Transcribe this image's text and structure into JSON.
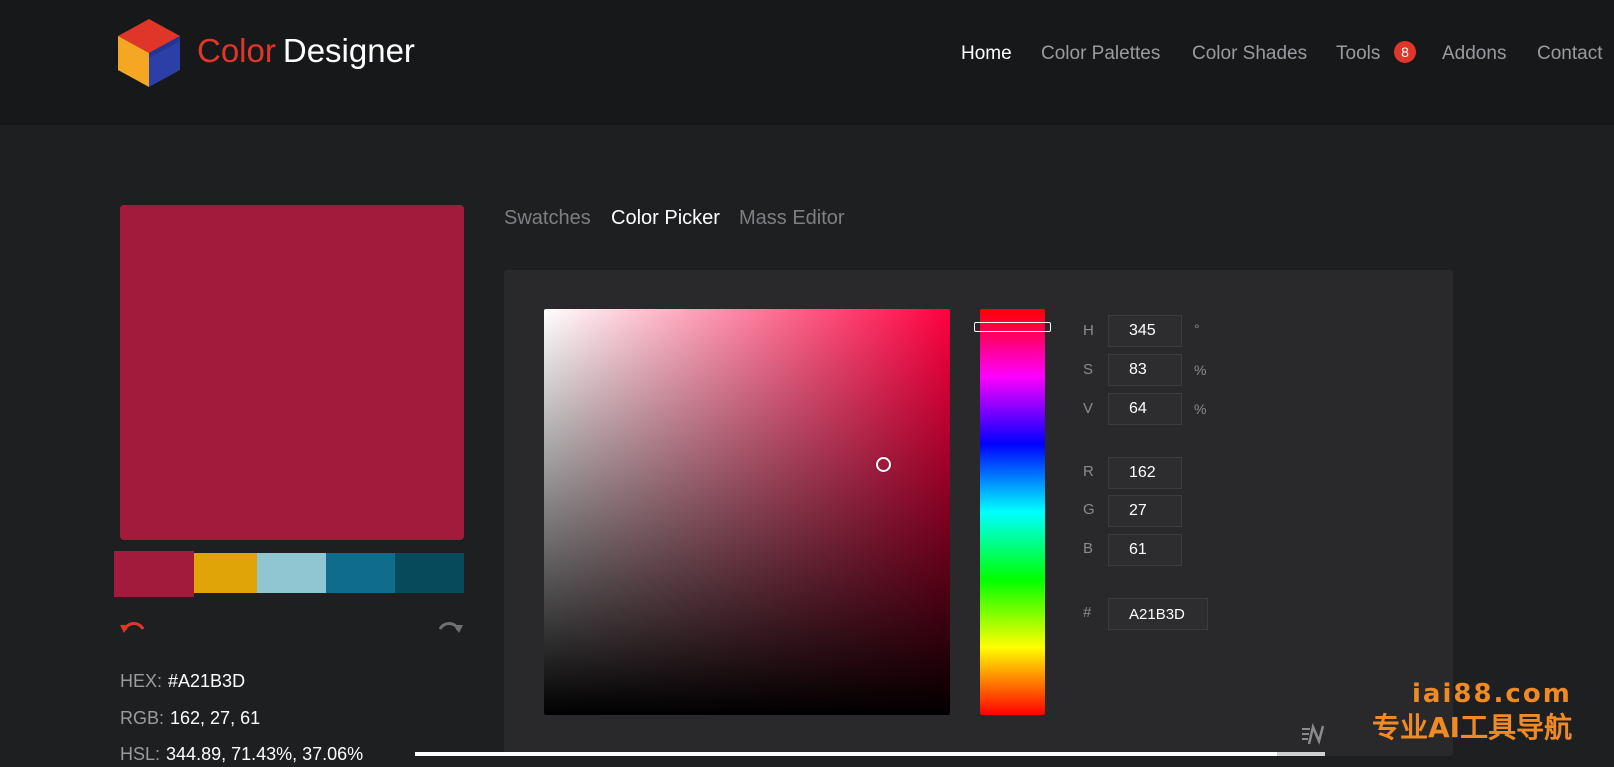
{
  "app": {
    "logo_word1": "Color",
    "logo_word2": "Designer",
    "logo_icon": "cube-icon",
    "colors": {
      "brand_red": "#e0362a",
      "cube_orange": "#f5a623",
      "cube_blue": "#2c3fa6"
    }
  },
  "nav": {
    "items": [
      {
        "label": "Home",
        "active": true
      },
      {
        "label": "Color Palettes",
        "active": false
      },
      {
        "label": "Color Shades",
        "active": false
      },
      {
        "label": "Tools",
        "active": false,
        "badge": "8"
      },
      {
        "label": "Addons",
        "active": false
      },
      {
        "label": "Contact",
        "active": false
      }
    ]
  },
  "current_color": {
    "hex_display": "#A21B3D",
    "swatch": "#A21B3D"
  },
  "palette": {
    "colors": [
      "#A21B3D",
      "#E0A409",
      "#8FC6D2",
      "#0F6C8A",
      "#074A5C"
    ],
    "selected_index": 0
  },
  "history": {
    "undo_icon": "undo-icon",
    "redo_icon": "redo-icon"
  },
  "info": {
    "hex_label": "HEX:",
    "hex_value": "#A21B3D",
    "rgb_label": "RGB:",
    "rgb_value": "162, 27, 61",
    "hsl_label": "HSL:",
    "hsl_value": "344.89, 71.43%, 37.06%"
  },
  "tabs": [
    {
      "label": "Swatches",
      "active": false
    },
    {
      "label": "Color Picker",
      "active": true
    },
    {
      "label": "Mass Editor",
      "active": false
    }
  ],
  "picker": {
    "hue_degrees": 345,
    "saturation_percent": 83,
    "value_percent": 64,
    "fields": {
      "h": {
        "label": "H",
        "value": "345",
        "unit": "°"
      },
      "s": {
        "label": "S",
        "value": "83",
        "unit": "%"
      },
      "v": {
        "label": "V",
        "value": "64",
        "unit": "%"
      },
      "r": {
        "label": "R",
        "value": "162"
      },
      "g": {
        "label": "G",
        "value": "27"
      },
      "b": {
        "label": "B",
        "value": "61"
      },
      "hex": {
        "label": "#",
        "value": "A21B3D"
      }
    }
  },
  "watermark": {
    "line1": "iai88.com",
    "line2": "专业AI工具导航"
  }
}
